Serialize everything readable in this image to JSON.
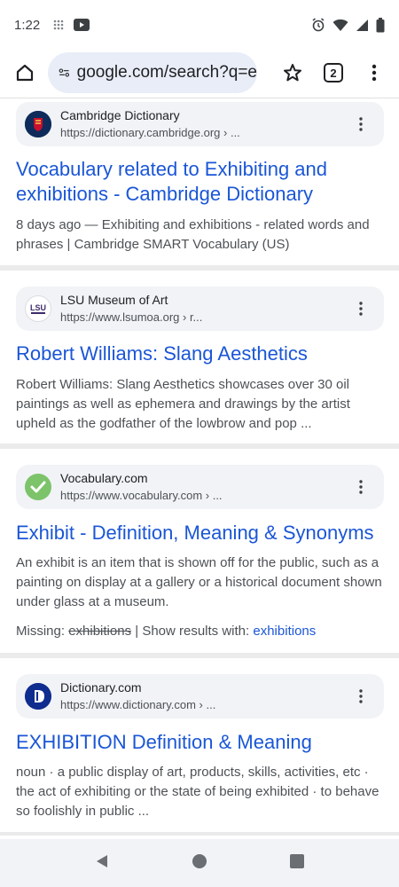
{
  "status_bar": {
    "time": "1:22"
  },
  "toolbar": {
    "url": "google.com/search?q=e",
    "tab_count": "2"
  },
  "results": [
    {
      "site_name": "Cambridge Dictionary",
      "site_url": "https://dictionary.cambridge.org › ...",
      "title": "Vocabulary related to Exhibiting and exhibitions - Cambridge Dictionary",
      "snippet": "8 days ago — Exhibiting and exhibitions - related words and phrases | Cambridge SMART Vocabulary (US)"
    },
    {
      "site_name": "LSU Museum of Art",
      "site_url": "https://www.lsumoa.org › r...",
      "title": "Robert Williams: Slang Aesthetics",
      "snippet": "Robert Williams: Slang Aesthetics showcases over 30 oil paintings as well as ephemera and drawings by the artist upheld as the godfather of the lowbrow and pop ...",
      "favicon_text": "LSU"
    },
    {
      "site_name": "Vocabulary.com",
      "site_url": "https://www.vocabulary.com › ...",
      "title": "Exhibit - Definition, Meaning & Synonyms",
      "snippet": "An exhibit is an item that is shown off for the public, such as a painting on display at a gallery or a historical document shown under glass at a museum.",
      "missing_label": "Missing:",
      "missing_term": "exhibitions",
      "show_results_label": "| Show results with:",
      "show_results_link": "exhibitions"
    },
    {
      "site_name": "Dictionary.com",
      "site_url": "https://www.dictionary.com › ...",
      "title": "EXHIBITION Definition & Meaning",
      "snippet": "noun · a public display of art, products, skills, activities, etc · the act of exhibiting or the state of being exhibited · to behave so foolishly in public ..."
    }
  ],
  "colors": {
    "link": "#1a56d6",
    "url_pill": "#e8edf7",
    "source_card": "#f1f3f6",
    "vocab_green": "#7cc36a",
    "dictcom_blue": "#0f2c8f"
  }
}
